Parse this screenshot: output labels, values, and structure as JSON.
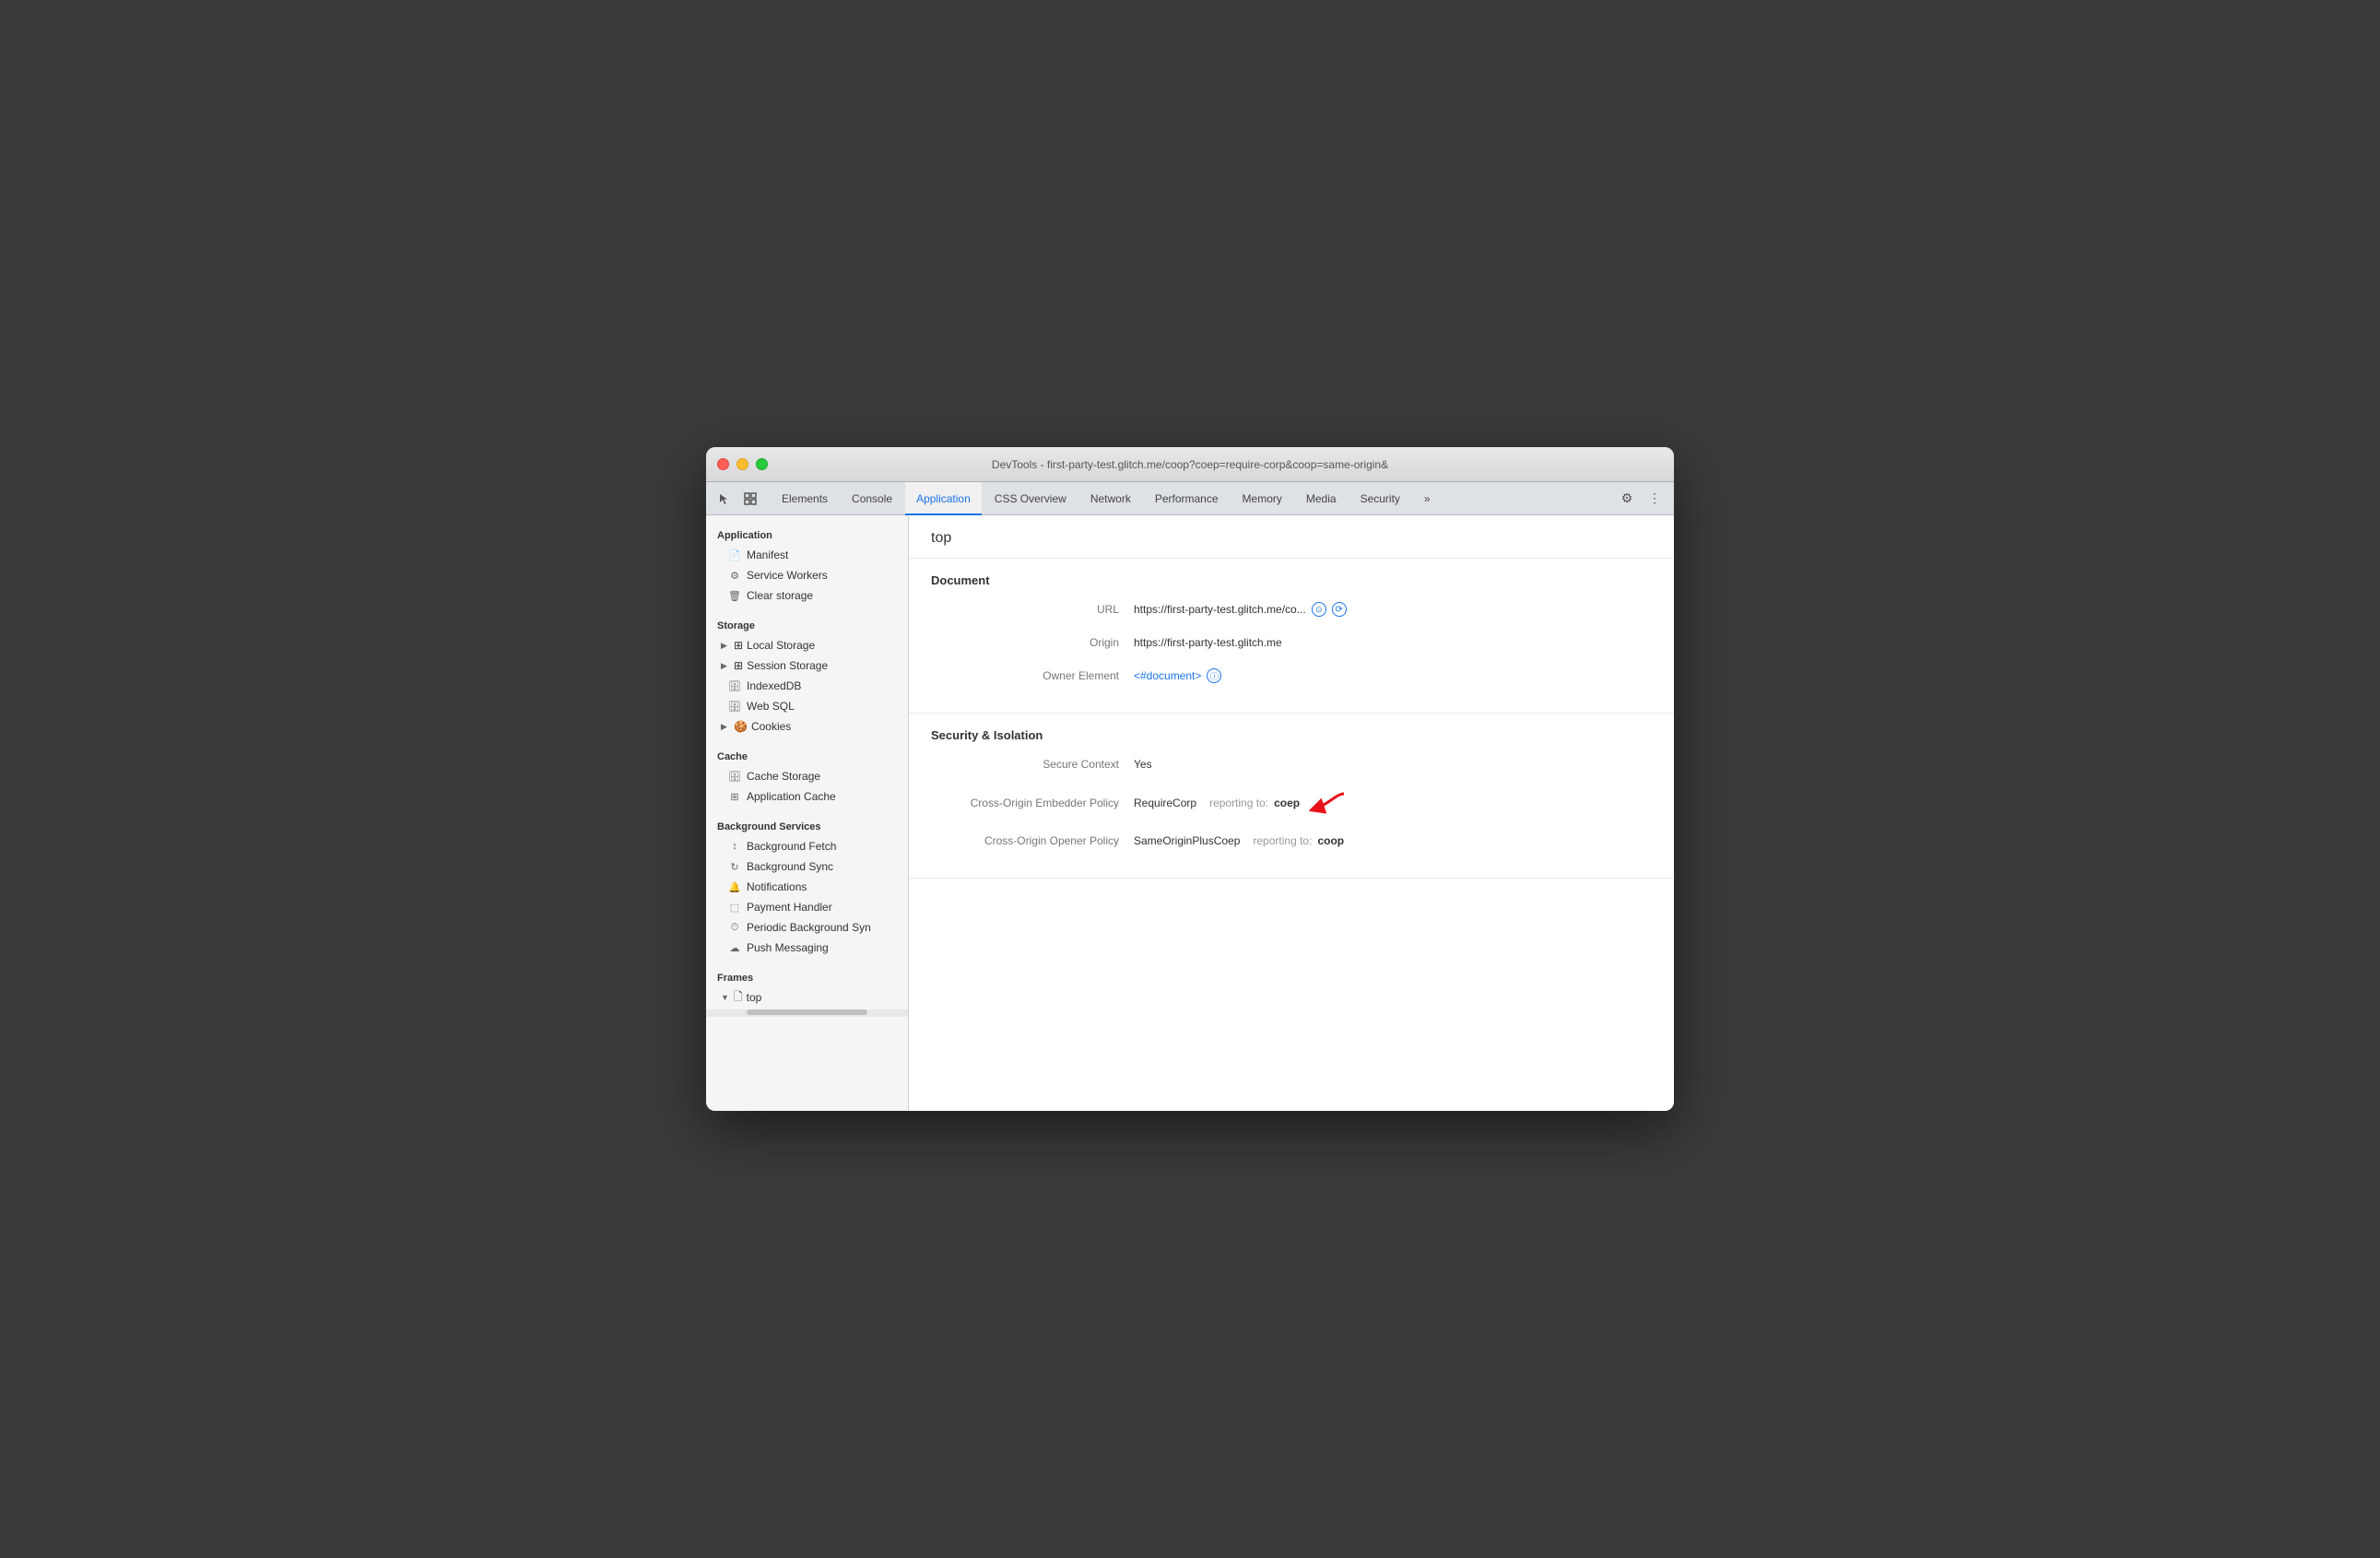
{
  "window": {
    "title": "DevTools - first-party-test.glitch.me/coop?coep=require-corp&coop=same-origin&"
  },
  "tabs": {
    "items": [
      {
        "label": "Elements",
        "active": false
      },
      {
        "label": "Console",
        "active": false
      },
      {
        "label": "Application",
        "active": true
      },
      {
        "label": "CSS Overview",
        "active": false
      },
      {
        "label": "Network",
        "active": false
      },
      {
        "label": "Performance",
        "active": false
      },
      {
        "label": "Memory",
        "active": false
      },
      {
        "label": "Media",
        "active": false
      },
      {
        "label": "Security",
        "active": false
      },
      {
        "label": "»",
        "active": false
      }
    ]
  },
  "sidebar": {
    "sections": {
      "application": {
        "header": "Application",
        "items": [
          {
            "label": "Manifest",
            "icon": "📄"
          },
          {
            "label": "Service Workers",
            "icon": "⚙"
          },
          {
            "label": "Clear storage",
            "icon": "🗑"
          }
        ]
      },
      "storage": {
        "header": "Storage",
        "items": [
          {
            "label": "Local Storage",
            "icon": "▶ ⊞",
            "hasArrow": true
          },
          {
            "label": "Session Storage",
            "icon": "▶ ⊞",
            "hasArrow": true
          },
          {
            "label": "IndexedDB",
            "icon": "🗄"
          },
          {
            "label": "Web SQL",
            "icon": "🗄"
          },
          {
            "label": "Cookies",
            "icon": "▶ 🍪",
            "hasArrow": true
          }
        ]
      },
      "cache": {
        "header": "Cache",
        "items": [
          {
            "label": "Cache Storage",
            "icon": "🗄"
          },
          {
            "label": "Application Cache",
            "icon": "⊞"
          }
        ]
      },
      "backgroundServices": {
        "header": "Background Services",
        "items": [
          {
            "label": "Background Fetch",
            "icon": "↕"
          },
          {
            "label": "Background Sync",
            "icon": "↻"
          },
          {
            "label": "Notifications",
            "icon": "🔔"
          },
          {
            "label": "Payment Handler",
            "icon": "🖥"
          },
          {
            "label": "Periodic Background Syn",
            "icon": "⏱"
          },
          {
            "label": "Push Messaging",
            "icon": "☁"
          }
        ]
      },
      "frames": {
        "header": "Frames",
        "items": [
          {
            "label": "top",
            "icon": "▼ 🗋",
            "hasArrow": true
          }
        ]
      }
    }
  },
  "content": {
    "page_title": "top",
    "document_section": {
      "title": "Document",
      "fields": [
        {
          "label": "URL",
          "value": "https://first-party-test.glitch.me/co...",
          "has_icons": true
        },
        {
          "label": "Origin",
          "value": "https://first-party-test.glitch.me"
        },
        {
          "label": "Owner Element",
          "value": "<#document>",
          "is_link": true,
          "has_circle_icon": true
        }
      ]
    },
    "security_section": {
      "title": "Security & Isolation",
      "fields": [
        {
          "label": "Secure Context",
          "value": "Yes"
        },
        {
          "label": "Cross-Origin Embedder Policy",
          "policy_value": "RequireCorp",
          "reporting_label": "reporting to:",
          "reporting_value": "coep",
          "has_red_arrow": true
        },
        {
          "label": "Cross-Origin Opener Policy",
          "policy_value": "SameOriginPlusCoep",
          "reporting_label": "reporting to:",
          "reporting_value": "coop"
        }
      ]
    }
  }
}
